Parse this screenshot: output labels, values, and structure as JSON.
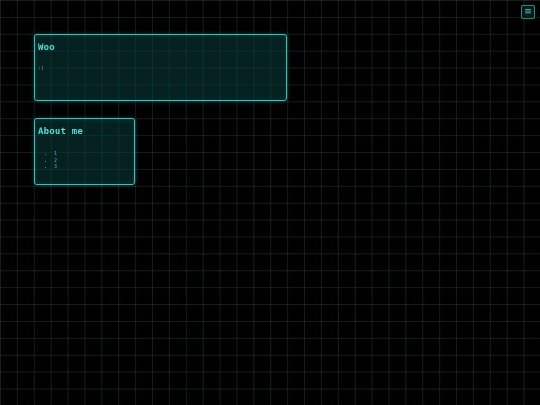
{
  "menu": {
    "icon_name": "hamburger-menu-icon",
    "glyph": "≡"
  },
  "panels": [
    {
      "title": "Woo",
      "body": ":)"
    },
    {
      "title": "About me",
      "items": [
        "1",
        "2",
        "3"
      ]
    }
  ],
  "colors": {
    "accent": "#3fe6e0",
    "border": "#2fc4c0",
    "background": "#000000"
  }
}
